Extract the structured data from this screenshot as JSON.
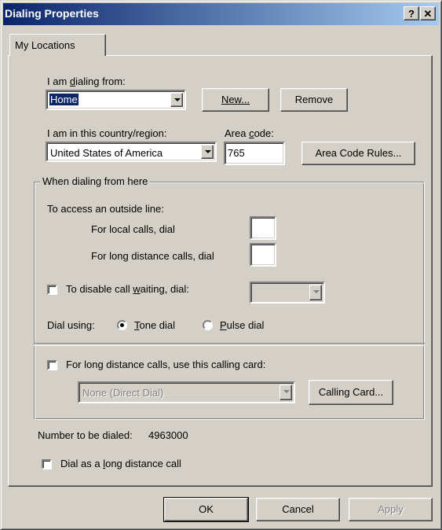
{
  "window": {
    "title": "Dialing Properties",
    "help_button": "?",
    "close_button": "✕"
  },
  "tabs": [
    {
      "label": "My Locations"
    }
  ],
  "location": {
    "dialing_from_label": "I am dialing from:",
    "dialing_from_value": "Home",
    "new_button": "New...",
    "remove_button": "Remove",
    "country_label": "I am in this country/region:",
    "country_value": "United States of America",
    "area_code_label": "Area code:",
    "area_code_value": "765",
    "area_code_rules_button": "Area Code Rules..."
  },
  "dialing_group": {
    "title": "When dialing from here",
    "outside_line_label": "To access an outside line:",
    "local_calls_label": "For local calls, dial",
    "local_calls_value": "",
    "long_distance_label": "For long distance calls, dial",
    "long_distance_value": "",
    "call_waiting_label": "To disable call waiting, dial:",
    "call_waiting_checked": false,
    "dial_using_label": "Dial using:",
    "tone_dial_label": "Tone dial",
    "pulse_dial_label": "Pulse dial",
    "selected_mode": "tone",
    "calling_card_label": "For long distance calls, use this calling card:",
    "calling_card_checked": false,
    "calling_card_value": "None (Direct Dial)",
    "calling_card_button": "Calling Card..."
  },
  "number_to_dial": {
    "label": "Number to be dialed:",
    "value": "4963000"
  },
  "long_distance_call": {
    "label": "Dial as a long distance call",
    "checked": false
  },
  "footer": {
    "ok": "OK",
    "cancel": "Cancel",
    "apply": "Apply"
  }
}
